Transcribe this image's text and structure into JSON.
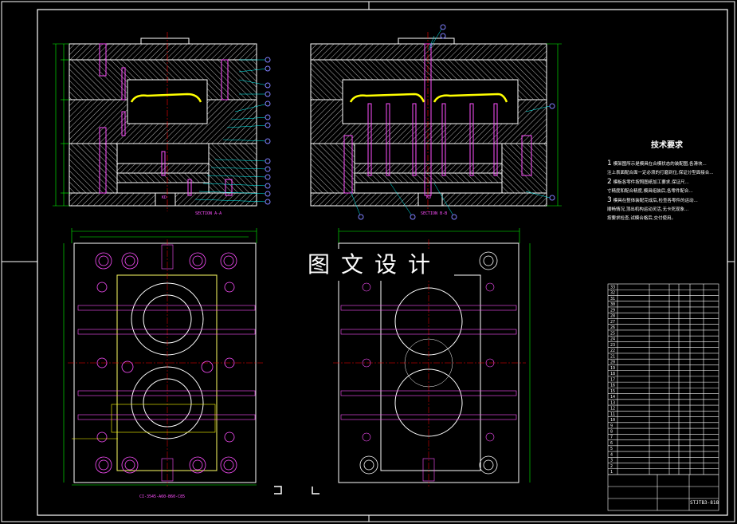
{
  "watermark": "图文设计",
  "tech_requirements": {
    "title": "技术要求",
    "items": [
      {
        "num": "1",
        "text": "模架图所示是模具在合模状态的装配图,各滑块..."
      },
      {
        "num": "",
        "text": "注上表面配合面一定必须的打磨到位,保证分型面接合..."
      },
      {
        "num": "2",
        "text": "模板各零件按照图纸加工要求,保证尺..."
      },
      {
        "num": "",
        "text": "寸精度和配合精度,模具组装后,各零件配合..."
      },
      {
        "num": "3",
        "text": "模具在整体装配完成后,检查各零件的运动..."
      },
      {
        "num": "",
        "text": "顺畅情况,顶出机构运动灵活,无卡死现象..."
      },
      {
        "num": "",
        "text": "按要求检查,试模合格后,交付使用。"
      }
    ]
  },
  "labels": {
    "section_a": "SECTION A-A",
    "section_b": "SECTION B-B",
    "kd": "KD",
    "bottom_note": "CI-3545-A60-B60-C85",
    "drawing_number": "STJTB3-818"
  },
  "colors": {
    "background": "#000000",
    "outline": "#ffffff",
    "hatch": "#ffffff",
    "dimension": "#00ff00",
    "section": "#ffff00",
    "center": "#ff0000",
    "leader": "#00ffff",
    "balloon": "#8080ff",
    "text": "#ff4fff"
  },
  "parts_table": {
    "rows": [
      "33",
      "32",
      "31",
      "30",
      "29",
      "28",
      "27",
      "26",
      "25",
      "24",
      "23",
      "22",
      "21",
      "20",
      "19",
      "18",
      "17",
      "16",
      "15",
      "14",
      "13",
      "12",
      "11",
      "10",
      "9",
      "8",
      "7",
      "6",
      "5",
      "4",
      "3",
      "2",
      "1"
    ]
  }
}
